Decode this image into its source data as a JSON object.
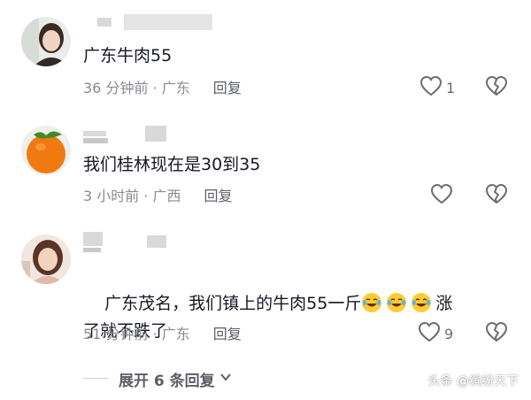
{
  "comments": [
    {
      "text": "广东牛肉55",
      "time_location": "36 分钟前 · 广东",
      "reply_label": "回复",
      "like_count": "1"
    },
    {
      "text": "我们桂林现在是30到35",
      "time_location": "3 小时前 · 广西",
      "reply_label": "回复",
      "like_count": ""
    },
    {
      "text_before_emoji": "广东茂名，我们镇上的牛肉55一斤",
      "emoji": "laugh-cry-emoji",
      "emoji_count": 3,
      "text_after_emoji": "涨",
      "text_line2": "了就不跌了",
      "time_location": "51 分钟前 · 广东",
      "reply_label": "回复",
      "like_count": "9"
    }
  ],
  "expand_replies_label": "展开 6 条回复",
  "watermark": "头条 @缤纷天下",
  "colors": {
    "text_primary": "#161823",
    "text_secondary": "#8a8b91",
    "icon": "#6b6d74"
  }
}
